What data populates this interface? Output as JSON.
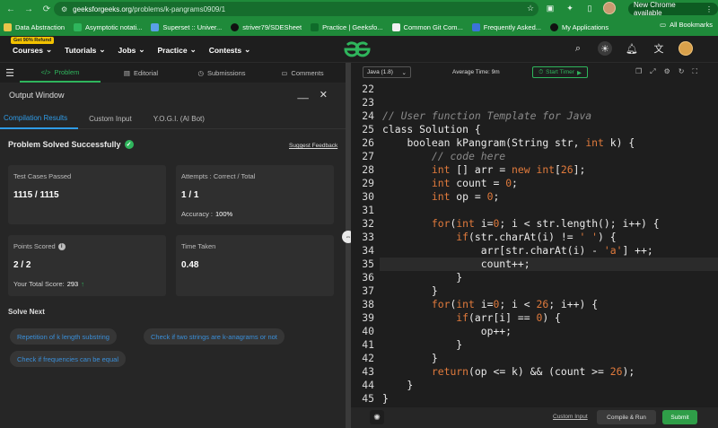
{
  "browser": {
    "url_host": "geeksforgeeks.org",
    "url_path": "/problems/k-pangrams0909/1",
    "new_chrome_label": "New Chrome available",
    "bookmarks": [
      "Data Abstraction",
      "Asymptotic notati...",
      "Superset :: Univer...",
      "striver79/SDESheet",
      "Practice | Geeksfo...",
      "Common Git Com...",
      "Frequently Asked...",
      "My Applications"
    ],
    "all_bookmarks": "All Bookmarks"
  },
  "site": {
    "refund_badge": "Get 90% Refund",
    "nav": [
      "Courses",
      "Tutorials",
      "Jobs",
      "Practice",
      "Contests"
    ],
    "logo_text": "GfG"
  },
  "problem_tabs": [
    "Problem",
    "Editorial",
    "Submissions",
    "Comments"
  ],
  "output": {
    "title": "Output Window",
    "minimize": "__",
    "close": "✕",
    "subtabs": [
      "Compilation Results",
      "Custom Input",
      "Y.O.G.I. (AI Bot)"
    ],
    "status": "Problem Solved Successfully",
    "feedback": "Suggest Feedback",
    "cards": {
      "tests_label": "Test Cases Passed",
      "tests_value": "1115 / 1115",
      "attempts_label": "Attempts : Correct / Total",
      "attempts_value": "1 / 1",
      "accuracy_label": "Accuracy :",
      "accuracy_value": "100%",
      "points_label": "Points Scored",
      "points_value": "2 / 2",
      "total_label": "Your Total Score:",
      "total_value": "293",
      "time_label": "Time Taken",
      "time_value": "0.48"
    },
    "solve_next_title": "Solve Next",
    "solve_next": [
      "Repetition of k length substring",
      "Check if two strings are k-anagrams or not",
      "Check if frequencies can be equal"
    ]
  },
  "editor": {
    "language": "Java (1.8)",
    "avg_time": "Average Time: 9m",
    "timer": "Start Timer",
    "line_numbers": [
      "22",
      "23",
      "24",
      "25",
      "26",
      "27",
      "28",
      "29",
      "30",
      "31",
      "32",
      "33",
      "34",
      "35",
      "36",
      "37",
      "38",
      "39",
      "40",
      "41",
      "42",
      "43",
      "44",
      "45"
    ],
    "custom_input": "Custom Input",
    "compile_run": "Compile & Run",
    "submit": "Submit"
  },
  "colors": {
    "brand_green": "#2fb55c",
    "link_blue": "#2f9be6",
    "chrome_green": "#1f8a3a"
  }
}
